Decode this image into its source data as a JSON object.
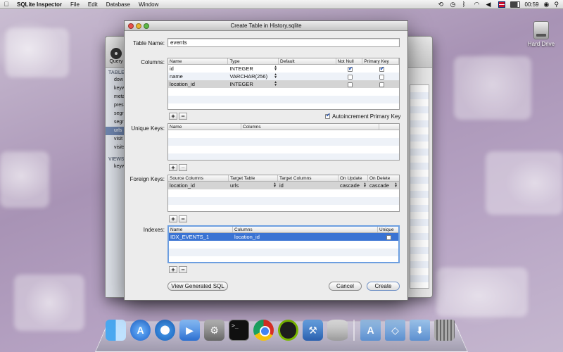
{
  "menubar": {
    "app_name": "SQLite Inspector",
    "menus": [
      "File",
      "Edit",
      "Database",
      "Window"
    ],
    "time": "00:59"
  },
  "desktop": {
    "hard_drive_label": "Hard Drive"
  },
  "main_window": {
    "query_label": "Query",
    "sidebar": {
      "tables_header": "TABLE",
      "tables": [
        "dow",
        "keyw",
        "meta",
        "pres",
        "segr",
        "segr",
        "urls",
        "visit",
        "visits"
      ],
      "selected_index": 6,
      "views_header": "VIEWS",
      "views": [
        "keyw"
      ]
    }
  },
  "dialog": {
    "title": "Create Table in History.sqlite",
    "table_name_label": "Table Name:",
    "table_name_value": "events",
    "columns_label": "Columns:",
    "columns_headers": [
      "Name",
      "Type",
      "Default",
      "Not Null",
      "Primary Key"
    ],
    "columns_rows": [
      {
        "name": "id",
        "type": "INTEGER",
        "default": "",
        "not_null": true,
        "primary_key": true
      },
      {
        "name": "name",
        "type": "VARCHAR(256)",
        "default": "",
        "not_null": false,
        "primary_key": false
      },
      {
        "name": "location_id",
        "type": "INTEGER",
        "default": "",
        "not_null": false,
        "primary_key": false
      }
    ],
    "autoincrement_label": "Autoincrement Primary Key",
    "autoincrement_checked": true,
    "unique_keys_label": "Unique Keys:",
    "unique_headers": [
      "Name",
      "Columns"
    ],
    "foreign_keys_label": "Foreign Keys:",
    "fk_headers": [
      "Source Columns",
      "Target Table",
      "Target Columns",
      "On Update",
      "On Delete"
    ],
    "fk_rows": [
      {
        "source": "location_id",
        "target_table": "urls",
        "target_columns": "id",
        "on_update": "cascade",
        "on_delete": "cascade"
      }
    ],
    "indexes_label": "Indexes:",
    "index_headers": [
      "Name",
      "Columns",
      "Unique"
    ],
    "index_rows": [
      {
        "name": "IDX_EVENTS_1",
        "columns": "location_id",
        "unique": false
      }
    ],
    "add_symbol": "+",
    "remove_symbol": "−",
    "view_sql_button": "View Generated SQL",
    "cancel_button": "Cancel",
    "create_button": "Create"
  }
}
